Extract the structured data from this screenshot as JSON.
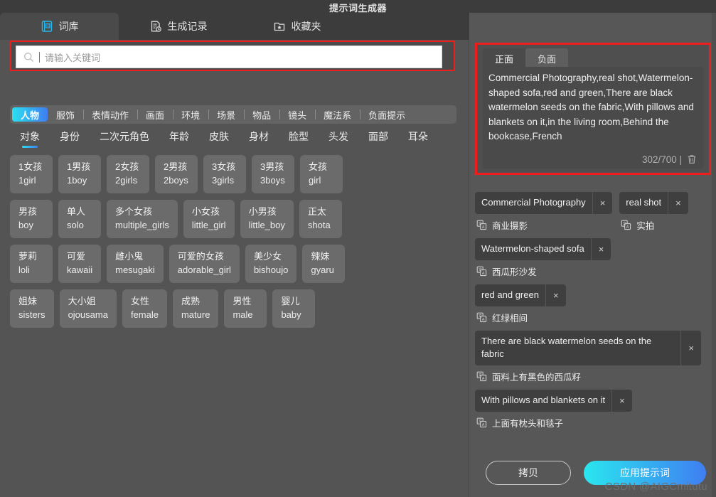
{
  "window": {
    "title": "提示词生成器"
  },
  "tabs": [
    {
      "label": "词库",
      "icon": "dictionary-book-icon",
      "active": true
    },
    {
      "label": "生成记录",
      "icon": "history-document-icon",
      "active": false
    },
    {
      "label": "收藏夹",
      "icon": "folder-star-icon",
      "active": false
    }
  ],
  "search": {
    "placeholder": "请输入关键词",
    "value": "",
    "icon": "search-icon"
  },
  "categories": [
    {
      "label": "人物",
      "active": true
    },
    {
      "label": "服饰",
      "active": false
    },
    {
      "label": "表情动作",
      "active": false
    },
    {
      "label": "画面",
      "active": false
    },
    {
      "label": "环境",
      "active": false
    },
    {
      "label": "场景",
      "active": false
    },
    {
      "label": "物品",
      "active": false
    },
    {
      "label": "镜头",
      "active": false
    },
    {
      "label": "魔法系",
      "active": false
    },
    {
      "label": "负面提示",
      "active": false
    }
  ],
  "subcategories": [
    {
      "label": "对象",
      "active": true
    },
    {
      "label": "身份",
      "active": false
    },
    {
      "label": "二次元角色",
      "active": false
    },
    {
      "label": "年龄",
      "active": false
    },
    {
      "label": "皮肤",
      "active": false
    },
    {
      "label": "身材",
      "active": false
    },
    {
      "label": "脸型",
      "active": false
    },
    {
      "label": "头发",
      "active": false
    },
    {
      "label": "面部",
      "active": false
    },
    {
      "label": "耳朵",
      "active": false
    }
  ],
  "word_rows": [
    [
      {
        "cn": "1女孩",
        "en": "1girl"
      },
      {
        "cn": "1男孩",
        "en": "1boy"
      },
      {
        "cn": "2女孩",
        "en": "2girls"
      },
      {
        "cn": "2男孩",
        "en": "2boys"
      },
      {
        "cn": "3女孩",
        "en": "3girls"
      },
      {
        "cn": "3男孩",
        "en": "3boys"
      },
      {
        "cn": "女孩",
        "en": "girl"
      }
    ],
    [
      {
        "cn": "男孩",
        "en": "boy"
      },
      {
        "cn": "单人",
        "en": "solo"
      },
      {
        "cn": "多个女孩",
        "en": "multiple_girls"
      },
      {
        "cn": "小女孩",
        "en": "little_girl"
      },
      {
        "cn": "小男孩",
        "en": "little_boy"
      },
      {
        "cn": "正太",
        "en": "shota"
      }
    ],
    [
      {
        "cn": "萝莉",
        "en": "loli"
      },
      {
        "cn": "可爱",
        "en": "kawaii"
      },
      {
        "cn": "雌小鬼",
        "en": "mesugaki"
      },
      {
        "cn": "可爱的女孩",
        "en": "adorable_girl"
      },
      {
        "cn": "美少女",
        "en": "bishoujo"
      },
      {
        "cn": "辣妹",
        "en": "gyaru"
      }
    ],
    [
      {
        "cn": "姐妹",
        "en": "sisters"
      },
      {
        "cn": "大小姐",
        "en": "ojousama"
      },
      {
        "cn": "女性",
        "en": "female"
      },
      {
        "cn": "成熟",
        "en": "mature"
      },
      {
        "cn": "男性",
        "en": "male"
      },
      {
        "cn": "婴儿",
        "en": "baby"
      }
    ]
  ],
  "prompt": {
    "tabs": [
      {
        "label": "正面",
        "active": true
      },
      {
        "label": "负面",
        "active": false
      }
    ],
    "text": "Commercial Photography,real shot,Watermelon-shaped sofa,red and green,There are black watermelon seeds on the fabric,With pillows and blankets on it,in the living room,Behind the bookcase,French",
    "counter": "302/700 |",
    "delete_icon": "trash-icon"
  },
  "chips": [
    {
      "layout": "pair",
      "items": [
        {
          "en": "Commercial Photography",
          "cn": "商业摄影",
          "remove": "×",
          "icon": "translate-icon"
        },
        {
          "en": "real shot",
          "cn": "实拍",
          "remove": "×",
          "icon": "translate-icon"
        }
      ]
    },
    {
      "layout": "single",
      "items": [
        {
          "en": "Watermelon-shaped sofa",
          "cn": "西瓜形沙发",
          "remove": "×",
          "icon": "translate-icon"
        }
      ]
    },
    {
      "layout": "single",
      "items": [
        {
          "en": "red and green",
          "cn": "红绿相间",
          "remove": "×",
          "icon": "translate-icon"
        }
      ]
    },
    {
      "layout": "wide",
      "items": [
        {
          "en": "There are black watermelon seeds on the fabric",
          "cn": "面料上有黑色的西瓜籽",
          "remove": "×",
          "icon": "translate-icon"
        }
      ]
    },
    {
      "layout": "single",
      "items": [
        {
          "en": "With pillows and blankets on it",
          "cn": "上面有枕头和毯子",
          "remove": "×",
          "icon": "translate-icon"
        }
      ]
    }
  ],
  "footer": {
    "copy_label": "拷贝",
    "apply_label": "应用提示词"
  },
  "watermark": "CSDN @AIGCmitutu",
  "colors": {
    "accent_start": "#2ae0ef",
    "accent_end": "#3f7ef2",
    "highlight_border": "#f01d1d",
    "panel_bg": "#575757",
    "card_bg": "#6b6b6b",
    "chip_bg": "#3f3f3f"
  }
}
